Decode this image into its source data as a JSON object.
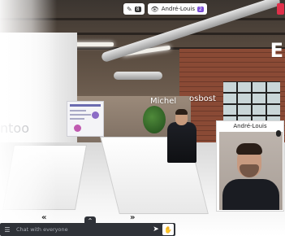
{
  "top_bar": {
    "edit_icon": "edit-icon",
    "edit_count": "8",
    "view_icon": "eye-icon",
    "user_name": "André-Louis",
    "user_badge": "2"
  },
  "scene": {
    "wall_text_left": "ntoo",
    "wall_text_right": "E",
    "name_tags": [
      "Michel",
      "osbost"
    ]
  },
  "video_tile": {
    "name": "André-Louis",
    "mic_icon": "microphone-icon"
  },
  "nav": {
    "prev_label": "«",
    "next_label": "»",
    "toggle_label": "⌃"
  },
  "chat": {
    "menu_icon": "chat-menu-icon",
    "placeholder": "Chat with everyone",
    "send_icon": "send-icon",
    "hand_icon": "raise-hand-icon"
  },
  "colors": {
    "accent_purple": "#7b4fd6",
    "alert_red": "#e0304a",
    "chat_bar": "#2f3238"
  }
}
